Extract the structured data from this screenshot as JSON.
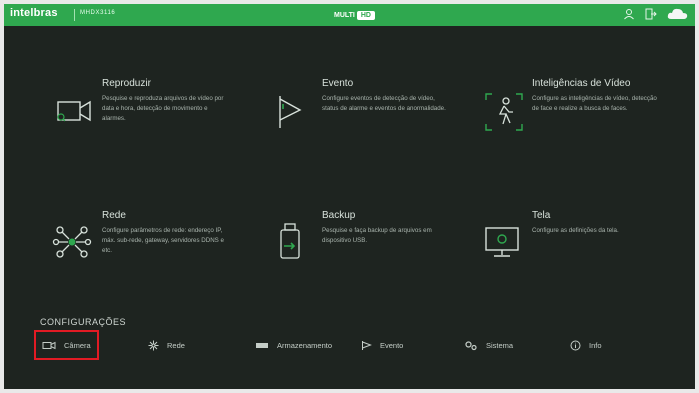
{
  "topbar": {
    "brand": "intelbras",
    "model": "MHDX3116",
    "title_main": "MULTI",
    "title_badge": "HD",
    "icons": [
      "user-icon",
      "logout-icon",
      "cloud-icon"
    ]
  },
  "modules": [
    {
      "title": "Reproduzir",
      "desc": "Pesquise e reproduza arquivos de vídeo por data e hora, detecção de movimento e alarmes.",
      "icon": "playback-camera-icon"
    },
    {
      "title": "Evento",
      "desc": "Configure eventos de detecção de vídeo, status de alarme e eventos de anormalidade.",
      "icon": "event-flag-icon"
    },
    {
      "title": "Inteligências de Vídeo",
      "desc": "Configure as inteligências de vídeo, detecção de face e realize a busca de faces.",
      "icon": "person-detect-icon"
    },
    {
      "title": "Rede",
      "desc": "Configure parâmetros de rede: endereço IP, máx. sub-rede, gateway, servidores DDNS e etc.",
      "icon": "network-icon"
    },
    {
      "title": "Backup",
      "desc": "Pesquise e faça backup de arquivos em dispositivo USB.",
      "icon": "usb-backup-icon"
    },
    {
      "title": "Tela",
      "desc": "Configure as definições da tela.",
      "icon": "monitor-icon"
    }
  ],
  "config": {
    "heading": "CONFIGURAÇÕES",
    "items": [
      {
        "label": "Câmera",
        "icon": "camera-icon",
        "active": true
      },
      {
        "label": "Rede",
        "icon": "network-small-icon",
        "active": false
      },
      {
        "label": "Armazenamento",
        "icon": "storage-icon",
        "active": false
      },
      {
        "label": "Evento",
        "icon": "event-small-icon",
        "active": false
      },
      {
        "label": "Sistema",
        "icon": "gears-icon",
        "active": false
      },
      {
        "label": "Info",
        "icon": "info-icon",
        "active": false
      }
    ]
  },
  "colors": {
    "accent": "#2fa84f",
    "highlight": "#e21b24",
    "background": "#1e2420"
  }
}
